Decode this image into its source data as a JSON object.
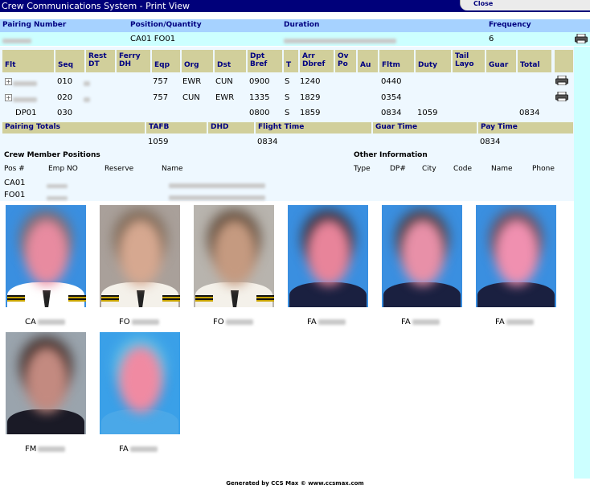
{
  "window": {
    "title": "Crew Communications System - Print View",
    "close_label": "Close"
  },
  "header": {
    "labels": {
      "pairing": "Pairing Number",
      "position": "Position/Quantity",
      "duration": "Duration",
      "frequency": "Frequency"
    },
    "values": {
      "position": "CA01 FO01",
      "frequency": "6"
    }
  },
  "legs": {
    "columns": [
      {
        "key": "flt",
        "label": "Flt",
        "two_line": false
      },
      {
        "key": "seq",
        "label": "Seq",
        "two_line": false
      },
      {
        "key": "rest",
        "label": "Rest\nDT",
        "two_line": true
      },
      {
        "key": "ferry",
        "label": "Ferry\nDH",
        "two_line": true
      },
      {
        "key": "eqp",
        "label": "Eqp",
        "two_line": false
      },
      {
        "key": "org",
        "label": "Org",
        "two_line": false
      },
      {
        "key": "dst",
        "label": "Dst",
        "two_line": false
      },
      {
        "key": "dpt",
        "label": "Dpt\nBref",
        "two_line": true
      },
      {
        "key": "t",
        "label": "T",
        "two_line": false
      },
      {
        "key": "arr",
        "label": "Arr\nDbref",
        "two_line": true
      },
      {
        "key": "ov",
        "label": "Ov\nPo",
        "two_line": true
      },
      {
        "key": "au",
        "label": "Au",
        "two_line": false
      },
      {
        "key": "fltm",
        "label": "Fltm",
        "two_line": false
      },
      {
        "key": "duty",
        "label": "Duty",
        "two_line": false
      },
      {
        "key": "tail",
        "label": "Tail\nLayo",
        "two_line": true
      },
      {
        "key": "guar",
        "label": "Guar",
        "two_line": false
      },
      {
        "key": "total",
        "label": "Total",
        "two_line": false
      }
    ],
    "rows": [
      {
        "seq": "010",
        "eqp": "757",
        "org": "EWR",
        "dst": "CUN",
        "dpt": "0900",
        "t": "S",
        "arr": "1240",
        "fltm": "0440",
        "expander": "+"
      },
      {
        "seq": "020",
        "eqp": "757",
        "org": "CUN",
        "dst": "EWR",
        "dpt": "1335",
        "t": "S",
        "arr": "1829",
        "fltm": "0354",
        "expander": "+"
      }
    ],
    "duty_row": {
      "flt": "DP01",
      "seq": "030",
      "dpt": "0800",
      "t": "S",
      "arr": "1859",
      "fltm": "0834",
      "duty": "1059",
      "total": "0834"
    }
  },
  "totals": {
    "labels": {
      "pairing_totals": "Pairing Totals",
      "tafb": "TAFB",
      "dhd": "DHD",
      "flight_time": "Flight Time",
      "guar_time": "Guar Time",
      "pay_time": "Pay Time"
    },
    "values": {
      "tafb": "1059",
      "flight_time": "0834",
      "pay_time": "0834"
    }
  },
  "crew_positions": {
    "title": "Crew Member Positions",
    "headers": {
      "pos": "Pos #",
      "emp": "Emp NO",
      "reserve": "Reserve",
      "name": "Name"
    },
    "rows": [
      {
        "pos": "CA01"
      },
      {
        "pos": "FO01"
      }
    ]
  },
  "other_info": {
    "title": "Other Information",
    "headers": {
      "type": "Type",
      "dp": "DP#",
      "city": "City",
      "code": "Code",
      "name": "Name",
      "phone": "Phone"
    }
  },
  "photos": [
    {
      "label": "CA",
      "bg": "#3a8fe0",
      "face": "#e88ba0",
      "hair": "#7a6a70",
      "body": "#ffffff",
      "stripes": true
    },
    {
      "label": "FO",
      "bg": "#a9a09a",
      "face": "#d6a890",
      "hair": "#7a6553",
      "body": "#f4f1ea",
      "stripes": true
    },
    {
      "label": "FO",
      "bg": "#b8b4ae",
      "face": "#c59a80",
      "hair": "#5e4a3a",
      "body": "#f4f1ea",
      "stripes": true
    },
    {
      "label": "FA",
      "bg": "#3a8fe0",
      "face": "#e8849a",
      "hair": "#3b2e38",
      "body": "#1a2040",
      "stripes": false
    },
    {
      "label": "FA",
      "bg": "#3a8fe0",
      "face": "#e890a8",
      "hair": "#4a3a3e",
      "body": "#1a2040",
      "stripes": false
    },
    {
      "label": "FA",
      "bg": "#3a8fe0",
      "face": "#f090b0",
      "hair": "#6a4a56",
      "body": "#1a2040",
      "stripes": false
    },
    {
      "label": "FM",
      "bg": "#9aa4ad",
      "face": "#c38a80",
      "hair": "#3b2a26",
      "body": "#1a1a26",
      "stripes": false
    },
    {
      "label": "FA",
      "bg": "#3aa0e8",
      "face": "#f08aa2",
      "hair": "#60c0e8",
      "body": "#4aa8e8",
      "stripes": false
    }
  ],
  "footer": "Generated by CCS Max © www.ccsmax.com"
}
